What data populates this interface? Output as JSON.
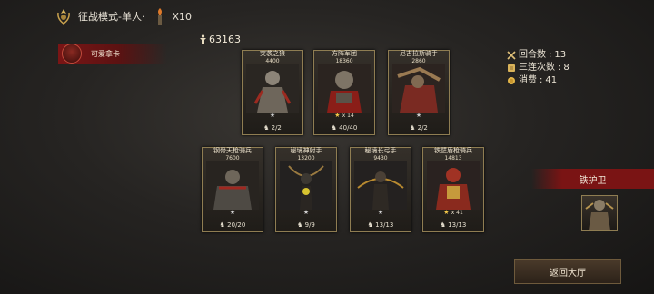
{
  "header": {
    "mode_label": "征战模式-单人·",
    "multiplier": "X10"
  },
  "score": "63163",
  "player": {
    "name": "可爱拿卡"
  },
  "stats": [
    {
      "label": "回合数",
      "value": "13",
      "icon": "crossed-swords-icon"
    },
    {
      "label": "三连次数",
      "value": "8",
      "icon": "scroll-icon"
    },
    {
      "label": "消费",
      "value": "41",
      "icon": "gold-coin-icon"
    }
  ],
  "cards": [
    {
      "name": "突袭之狼",
      "power": "4400",
      "stars": "",
      "star_count": "",
      "star_color": "#c8c8c8",
      "troops": "2/2"
    },
    {
      "name": "方阵军团",
      "power": "18360",
      "stars": "★",
      "star_count": "x 14",
      "star_color": "#f4c84a",
      "troops": "40/40"
    },
    {
      "name": "尼古拉斯骑手",
      "power": "2860",
      "stars": "",
      "star_count": "",
      "star_color": "#c8c8c8",
      "troops": "2/2"
    },
    {
      "name": "钢骨天枪骑兵",
      "power": "7600",
      "stars": "★",
      "star_count": "",
      "star_color": "#c8c8c8",
      "troops": "20/20"
    },
    {
      "name": "秘境神射手",
      "power": "13200",
      "stars": "★",
      "star_count": "",
      "star_color": "#c8c8c8",
      "troops": "9/9"
    },
    {
      "name": "秘境长弓手",
      "power": "9430",
      "stars": "★",
      "star_count": "",
      "star_color": "#c8c8c8",
      "troops": "13/13"
    },
    {
      "name": "铁壁盾枪骑兵",
      "power": "14813",
      "stars": "★",
      "star_count": "x 41",
      "star_color": "#f4c84a",
      "troops": "13/13"
    }
  ],
  "featured_unit": {
    "name": "铁护卫"
  },
  "buttons": {
    "return": "返回大厅"
  }
}
